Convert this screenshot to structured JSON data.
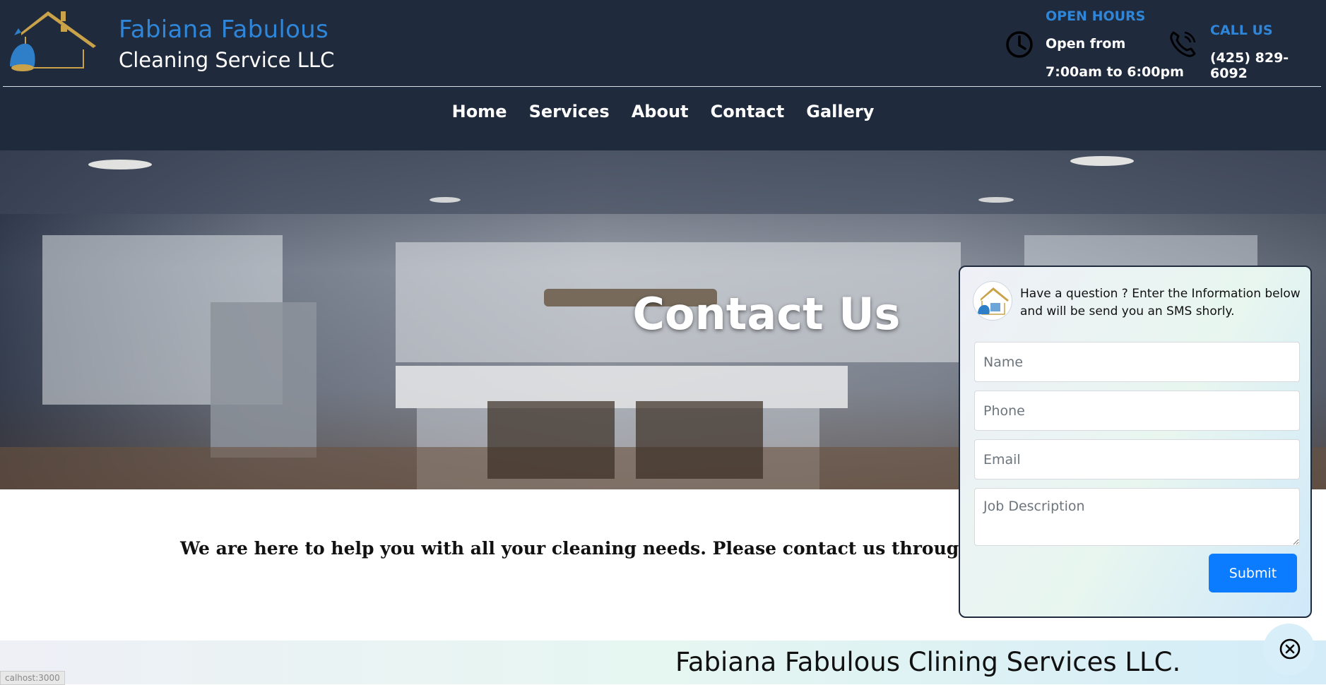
{
  "header": {
    "brand_line1": "Fabiana Fabulous",
    "brand_line2": "Cleaning Service LLC",
    "hours": {
      "title": "OPEN HOURS",
      "line1": "Open from",
      "line2": "7:00am to 6:00pm"
    },
    "call": {
      "title": "CALL US",
      "phone": "(425) 829-6092"
    }
  },
  "nav": {
    "items": [
      "Home",
      "Services",
      "About",
      "Contact",
      "Gallery"
    ]
  },
  "hero": {
    "title": "Contact Us"
  },
  "intro": {
    "text": "We are here to help you with all your cleaning needs. Please contact us through any of"
  },
  "footer": {
    "title": "Fabiana Fabulous Clining Services LLC."
  },
  "popup": {
    "message": "Have a question ? Enter the Information below and will be send you an SMS shorly.",
    "name_placeholder": "Name",
    "phone_placeholder": "Phone",
    "email_placeholder": "Email",
    "desc_placeholder": "Job Description",
    "submit_label": "Submit"
  },
  "status": {
    "url_hint": "calhost:3000"
  },
  "colors": {
    "header_bg": "#1f2a3c",
    "accent_blue": "#2f86d9",
    "button_blue": "#0b7bff"
  }
}
